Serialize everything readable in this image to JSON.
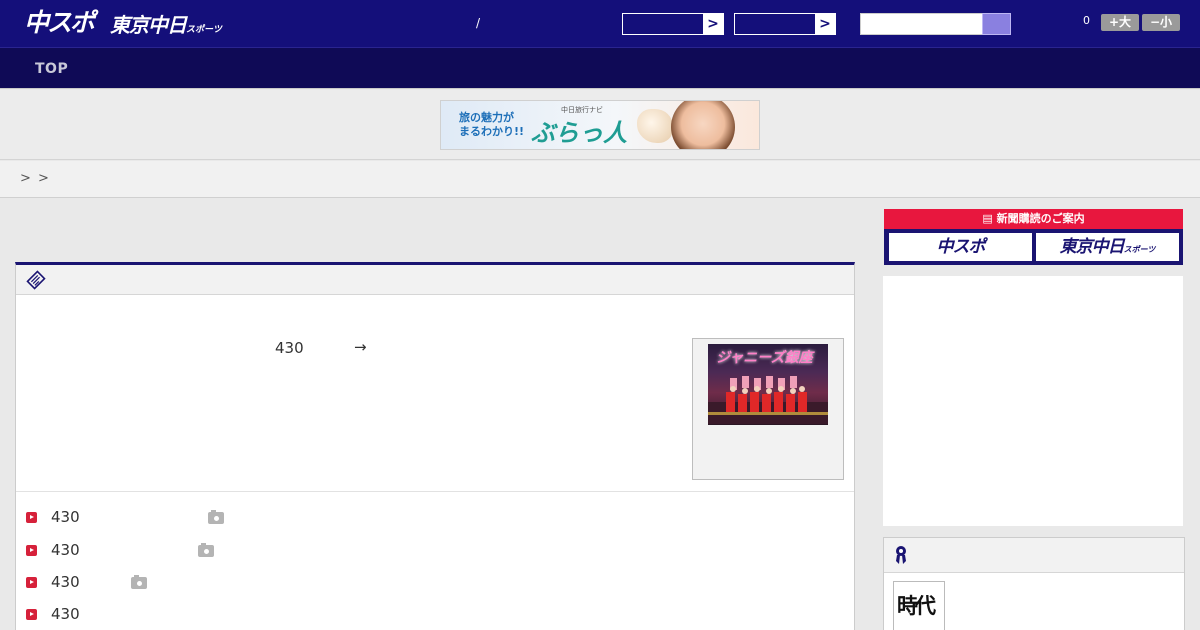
{
  "header": {
    "logo_chuspo": "中スポ",
    "logo_tokyo": "東京中日",
    "logo_tokyo_small": "スポーツ",
    "slash": "/",
    "select1_arrow": ">",
    "select2_arrow": ">",
    "font_size_count": "0",
    "font_larger": "+大",
    "font_smaller": "−小"
  },
  "nav": {
    "top_label": "TOP"
  },
  "banner": {
    "line1": "旅の魅力が",
    "line2": "まるわかり!!",
    "sub": "中日旅行ナビ",
    "brand": "ぶらっ人"
  },
  "breadcrumb": {
    "sep1": ">",
    "sep2": ">"
  },
  "article": {
    "lead_count": "430",
    "lead_arrow": "→",
    "thumb_caption": "ジャニーズ銀座",
    "list": [
      {
        "count": "430",
        "has_photo": true
      },
      {
        "count": "430",
        "has_photo": true
      },
      {
        "count": "430",
        "has_photo": true
      },
      {
        "count": "430",
        "has_photo": false
      }
    ]
  },
  "sidebar": {
    "subscribe_title": "新聞購読のご案内",
    "subscribe_chuspo": "中スポ",
    "subscribe_tokyo": "東京中日",
    "subscribe_tokyo_small": "スポーツ",
    "jidai_text": "時代"
  },
  "colors": {
    "header_bg": "#140f7a",
    "nav_bg": "#0f0a56",
    "accent_red": "#e8173e",
    "search_button": "#8a80e0"
  }
}
